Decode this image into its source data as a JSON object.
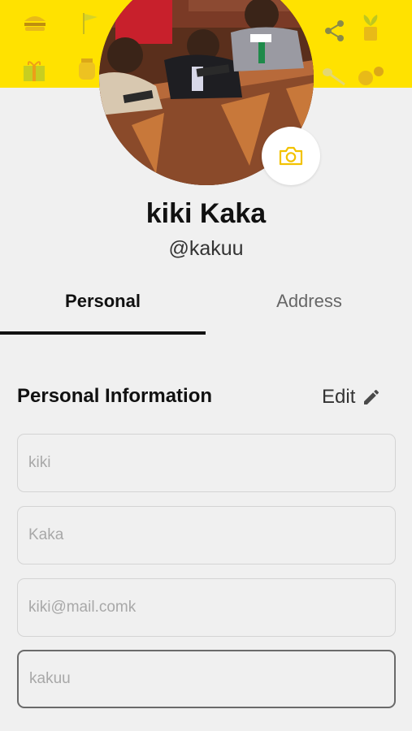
{
  "profile": {
    "full_name": "kiki Kaka",
    "username": "@kakuu"
  },
  "tabs": [
    {
      "label": "Personal",
      "active": true
    },
    {
      "label": "Address",
      "active": false
    }
  ],
  "section": {
    "title": "Personal Information",
    "edit_label": "Edit"
  },
  "fields": [
    {
      "value": "kiki"
    },
    {
      "value": "Kaka"
    },
    {
      "value": "kiki@mail.comk"
    },
    {
      "value": "kakuu"
    }
  ],
  "colors": {
    "cover": "#ffe200",
    "background": "#f0f0f0",
    "camera_icon": "#f2c200"
  },
  "icons": [
    "share-icon",
    "camera-icon",
    "pencil-icon"
  ]
}
